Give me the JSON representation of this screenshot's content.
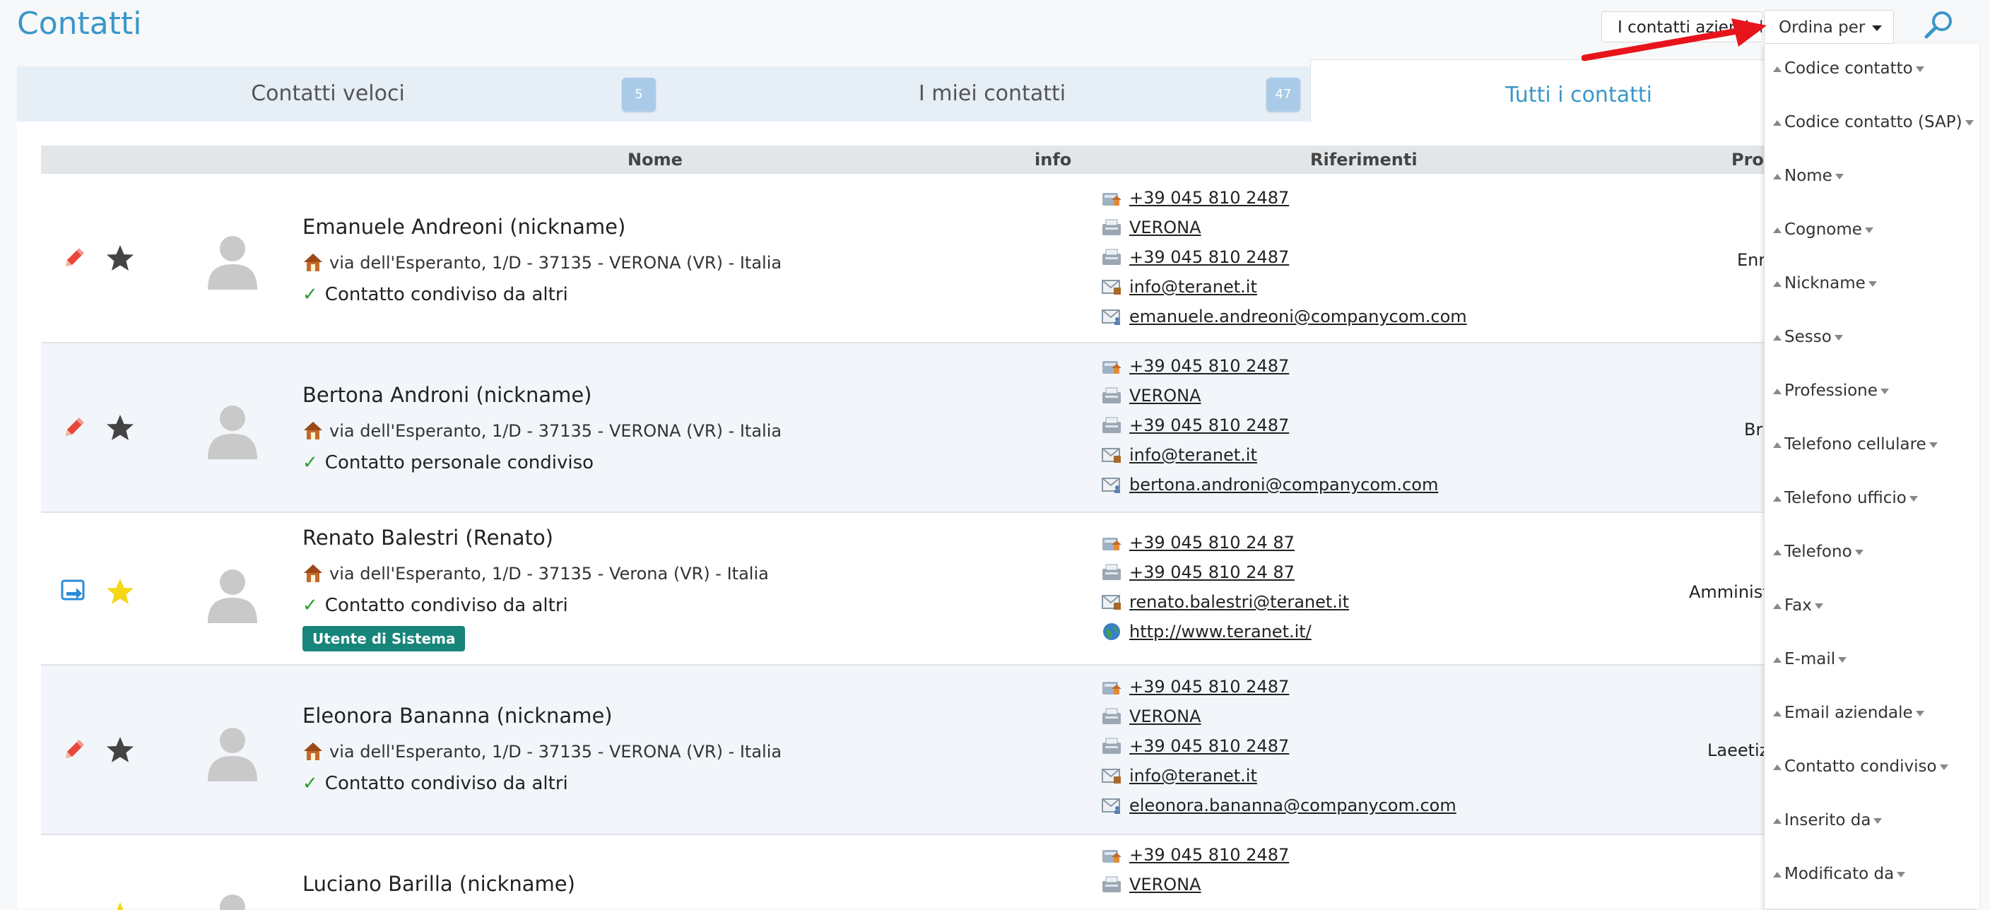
{
  "page": {
    "title": "Contatti"
  },
  "toolbar": {
    "company_contacts_label": "I contatti aziendali",
    "order_by_label": "Ordina per"
  },
  "tabs": [
    {
      "label": "Contatti veloci",
      "count": "5"
    },
    {
      "label": "I miei contatti",
      "count": "47"
    },
    {
      "label": "Tutti i contatti"
    }
  ],
  "table": {
    "columns": [
      "Nome",
      "info",
      "Riferimenti",
      "Proprietario"
    ]
  },
  "rows": [
    {
      "name": "Emanuele Andreoni (nickname)",
      "address": "via dell'Esperanto, 1/D - 37135 - VERONA (VR) - Italia",
      "status": "Contatto condiviso da altri",
      "owner": "Enrico",
      "favorite": false,
      "refs": [
        "+39 045 810 2487",
        "VERONA",
        "+39 045 810 2487",
        "info@teranet.it",
        "emanuele.andreoni@companycom.com"
      ]
    },
    {
      "name": "Bertona Androni (nickname)",
      "address": "via dell'Esperanto, 1/D - 37135 - VERONA (VR) - Italia",
      "status": "Contatto personale condiviso",
      "owner": "Bruno",
      "favorite": false,
      "refs": [
        "+39 045 810 2487",
        "VERONA",
        "+39 045 810 2487",
        "info@teranet.it",
        "bertona.androni@companycom.com"
      ]
    },
    {
      "name": "Renato Balestri (Renato)",
      "address": "via dell'Esperanto, 1/D - 37135 - Verona (VR) - Italia",
      "status": "Contatto condiviso da altri",
      "system_badge": "Utente di Sistema",
      "owner": "Amministratore",
      "favorite": true,
      "refs": [
        "+39 045 810 24 87",
        "+39 045 810 24 87",
        "renato.balestri@teranet.it",
        "http://www.teranet.it/"
      ]
    },
    {
      "name": "Eleonora Bananna (nickname)",
      "address": "via dell'Esperanto, 1/D - 37135 - VERONA (VR) - Italia",
      "status": "Contatto condiviso da altri",
      "owner": "Laeetizia",
      "favorite": false,
      "refs": [
        "+39 045 810 2487",
        "VERONA",
        "+39 045 810 2487",
        "info@teranet.it",
        "eleonora.bananna@companycom.com"
      ]
    },
    {
      "name": "Luciano Barilla (nickname)",
      "favorite": true,
      "refs": [
        "+39 045 810 2487",
        "VERONA"
      ]
    }
  ],
  "order_menu": [
    "Codice contatto",
    "Codice contatto (SAP)",
    "Nome",
    "Cognome",
    "Nickname",
    "Sesso",
    "Professione",
    "Telefono cellulare",
    "Telefono ufficio",
    "Telefono",
    "Fax",
    "E-mail",
    "Email aziendale",
    "Contatto condiviso",
    "Inserito da",
    "Modificato da"
  ],
  "colors": {
    "accent": "#3a97c9",
    "edit": "#e8463a",
    "star_favorite": "#f5d716",
    "star": "#444444",
    "system_badge": "#17857a",
    "arrow": "#e8141b"
  }
}
